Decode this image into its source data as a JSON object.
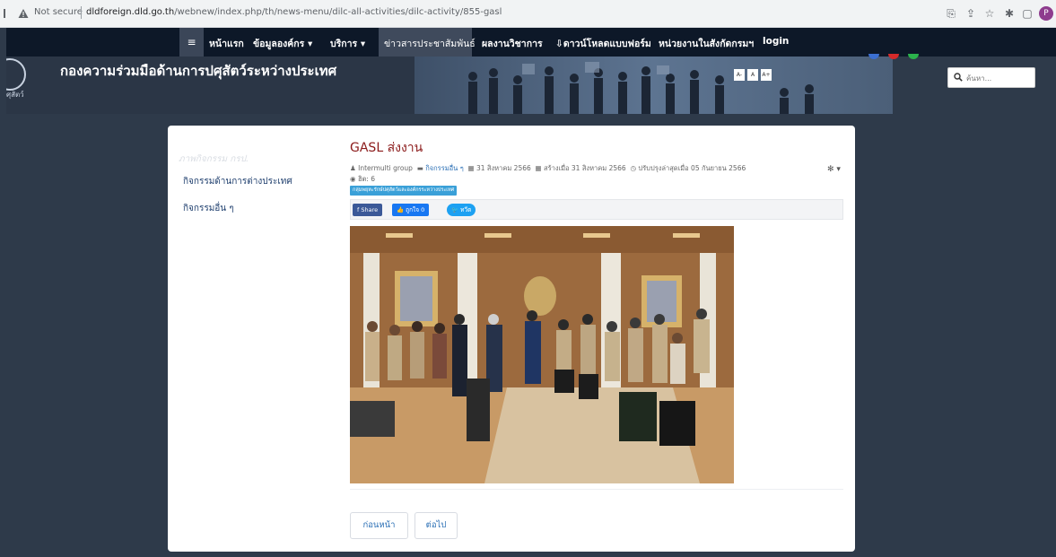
{
  "browser": {
    "security_label": "Not secure",
    "url_host": "dldforeign.dld.go.th",
    "url_path": "/webnew/index.php/th/news-menu/dilc-all-activities/dilc-activity/855-gasl",
    "profile_initial": "P"
  },
  "nav": {
    "menu_icon": "hamburger-icon",
    "items": [
      {
        "label": "หน้าแรก"
      },
      {
        "label": "ข้อมูลองค์กร ▾"
      },
      {
        "label": "บริการ ▾"
      },
      {
        "label": "ข่าวสารประชาสัมพันธ์"
      },
      {
        "label": "ผลงานวิชาการ"
      },
      {
        "label": "ดาวน์โหลดแบบฟอร์ม"
      },
      {
        "label": "หน่วยงานในสังกัดกรมฯ"
      },
      {
        "label": "login"
      }
    ]
  },
  "banner": {
    "title": "กองความร่วมมือด้านการปศุสัตว์ระหว่างประเทศ",
    "logo_text": "ศุสัตว์",
    "font_sizes": [
      "A-",
      "A",
      "A+"
    ]
  },
  "search": {
    "placeholder": "ค้นหา..."
  },
  "sidebar": {
    "heading": "ภาพกิจกรรม กรป.",
    "items": [
      {
        "label": "กิจกรรมด้านการต่างประเทศ"
      },
      {
        "label": "กิจกรรมอื่น ๆ"
      }
    ]
  },
  "article": {
    "title": "GASL ส่งงาน",
    "author": "Intermulti group",
    "category": "กิจกรรมอื่น ๆ",
    "date": "31 สิงหาคม 2566",
    "created": "สร้างเมื่อ 31 สิงหาคม 2566",
    "updated": "ปรับปรุงล่าสุดเมื่อ 05 กันยายน 2566",
    "hits": "ฮิต: 6",
    "tag": "กลุ่มพยุหะรักษ์ปศุสัตว์และองค์กรระหว่างประเทศ",
    "share": {
      "facebook": "Share",
      "like": "ถูกใจ 0",
      "tweet": "ทวีต"
    }
  },
  "pagination": {
    "prev": "ก่อนหน้า",
    "next": "ต่อไป"
  },
  "colors": {
    "nav_bg": "#0d1828",
    "page_bg": "#2e3a4a",
    "title_red": "#8b1a1a",
    "link_blue": "#2a6fb5"
  }
}
